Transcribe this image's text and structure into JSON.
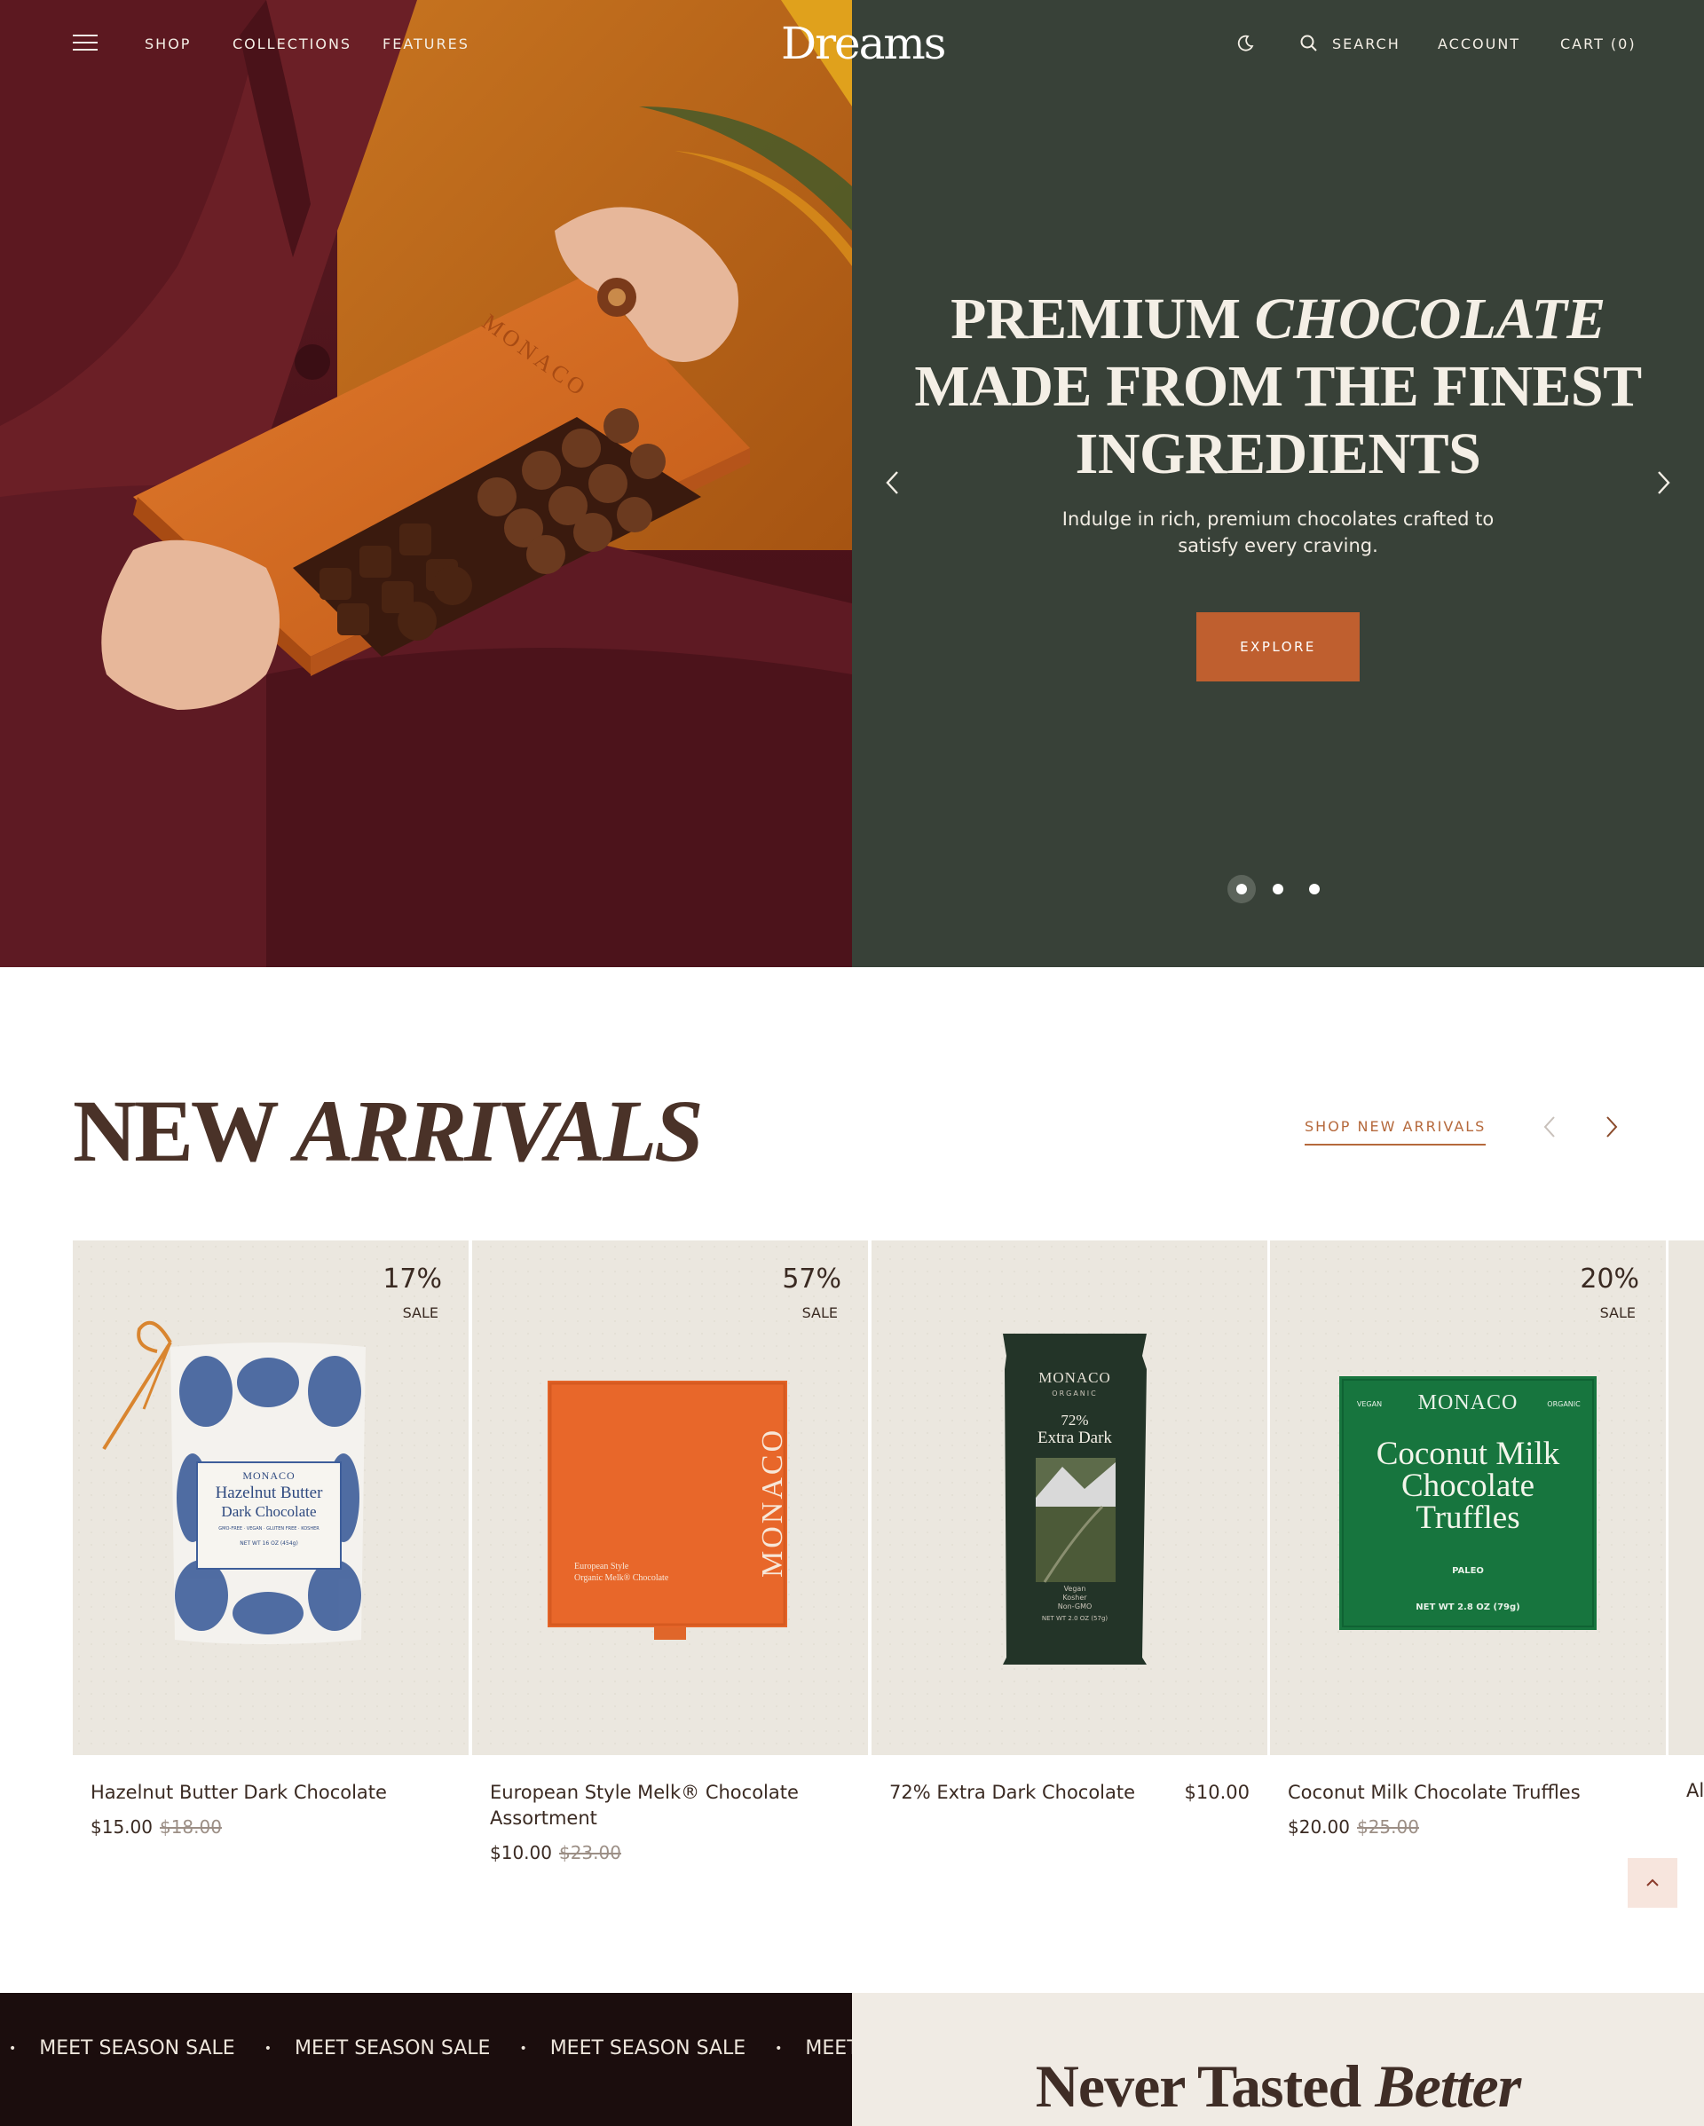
{
  "nav": {
    "menu_icon": "hamburger-icon",
    "shop": "SHOP",
    "collections": "COLLECTIONS",
    "features": "FEATURES",
    "logo": "Dreams",
    "theme_icon": "moon-icon",
    "search_icon": "search-icon",
    "search": "SEARCH",
    "account": "ACCOUNT",
    "cart": "CART (0)"
  },
  "hero": {
    "title_line1_plain": "PREMIUM ",
    "title_line1_italic": "CHOCOLATE",
    "title_line2": "MADE FROM THE FINEST",
    "title_line3": "INGREDIENTS",
    "subtitle": "Indulge in rich, premium chocolates crafted to satisfy every craving.",
    "cta": "EXPLORE",
    "prev_icon": "chevron-left-icon",
    "next_icon": "chevron-right-icon",
    "slides": 3,
    "active_slide": 1,
    "box_brand": "MONACO",
    "colors": {
      "panel": "#384138",
      "cta": "#bf5f2f"
    }
  },
  "new_arrivals": {
    "title_plain": "NEW ",
    "title_italic": "ARRIVALS",
    "link": "SHOP NEW ARRIVALS",
    "products": [
      {
        "name": "Hazelnut Butter Dark Chocolate",
        "price": "$15.00",
        "old_price": "$18.00",
        "sale_pct": "17%",
        "sale_label": "SALE",
        "pack_brand": "MONACO",
        "pack_line1": "Hazelnut Butter",
        "pack_line2": "Dark Chocolate",
        "pack_small": "GMO-FREE · VEGAN · GLUTEN FREE · KOSHER",
        "pack_weight": "NET WT 16 OZ (454g)"
      },
      {
        "name": "European Style Melk® Chocolate Assortment",
        "price": "$10.00",
        "old_price": "$23.00",
        "sale_pct": "57%",
        "sale_label": "SALE",
        "pack_brand": "MONACO",
        "pack_line1": "European Style",
        "pack_line2": "Organic Melk® Chocolate"
      },
      {
        "name": "72% Extra Dark Chocolate",
        "price": "$10.00",
        "old_price": "",
        "sale_pct": "",
        "sale_label": "",
        "pack_brand": "MONACO",
        "pack_sub": "ORGANIC",
        "pack_line1": "72%",
        "pack_line2": "Extra Dark",
        "pack_small": "Vegan",
        "pack_small2": "Kosher",
        "pack_small3": "Non-GMO",
        "pack_weight": "NET WT 2.0 OZ (57g)"
      },
      {
        "name": "Coconut Milk Chocolate Truffles",
        "price": "$20.00",
        "old_price": "$25.00",
        "sale_pct": "20%",
        "sale_label": "SALE",
        "pack_brand": "MONACO",
        "pack_tag_left": "VEGAN",
        "pack_tag_right": "ORGANIC",
        "pack_line1": "Coconut Milk",
        "pack_line2": "Chocolate",
        "pack_line3": "Truffles",
        "pack_small": "PALEO",
        "pack_weight": "NET WT 2.8 OZ (79g)"
      },
      {
        "name": "Al",
        "price": "",
        "old_price": ""
      }
    ]
  },
  "to_top_icon": "chevron-up-icon",
  "marquee": {
    "text": "MEET SEASON SALE",
    "bullet": "•"
  },
  "never": {
    "plain": "Never Tasted ",
    "italic": "Better"
  }
}
